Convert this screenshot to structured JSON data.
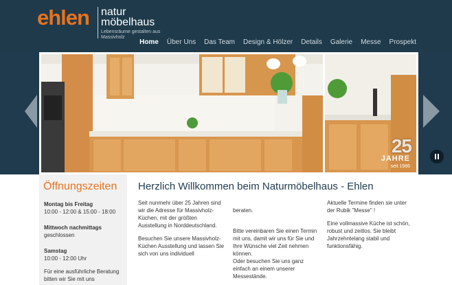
{
  "logo": {
    "word": "ehlen",
    "line1": "natur",
    "line2": "möbelhaus",
    "tagline": "Lebensräume gestalten aus Massivholz"
  },
  "nav": [
    "Home",
    "Über Uns",
    "Das Team",
    "Design & Hölzer",
    "Details",
    "Galerie",
    "Messe",
    "Prospekt"
  ],
  "slider": {
    "badge_number": "25",
    "badge_word": "JAHRE",
    "badge_since": "seit 1986"
  },
  "sidebar": {
    "title": "Öffnungszeiten",
    "blocks": [
      {
        "head": "Montag bis Freitag",
        "text": "10:00 - 12:00 & 15:00 - 18:00"
      },
      {
        "head": "Mittwoch nachmittags",
        "text": "geschlossen"
      },
      {
        "head": "Samstag",
        "text": "10:00 - 12:00 Uhr"
      },
      {
        "head": "",
        "text": "Für eine ausführliche Beratung bitten wir Sie mit uns"
      }
    ]
  },
  "main": {
    "title": "Herzlich Willkommen beim Naturmöbelhaus - Ehlen",
    "col1": [
      "Seit nunmehr über 25 Jahren sind wir die Adresse für Massivholz-Küchen, mit der größten Ausstellung in Norddeutschland.",
      "Besuchen Sie unsere Massivholz-Küchen Ausstellung und lassen Sie sich von uns individuell"
    ],
    "col2": [
      "beraten.",
      "Bitte vereinbaren Sie einen Termin mit uns, damit wir uns für Sie und Ihre Wünsche viel Zeit nehmen können.\nOder besuchen Sie uns ganz einfach an einem unserer Messestände."
    ],
    "col3": [
      "Aktuelle Termine finden sie unter der Rubik \"Messe\" !",
      "Eine vollmassive Küche ist schön, robust und zeitlos. Sie bleibt Jahrzehntelang stabil und funktionsfähig."
    ]
  },
  "colors": {
    "accent": "#e7731f",
    "header_bg": "#1e3a4b",
    "title": "#1f3b4d"
  }
}
